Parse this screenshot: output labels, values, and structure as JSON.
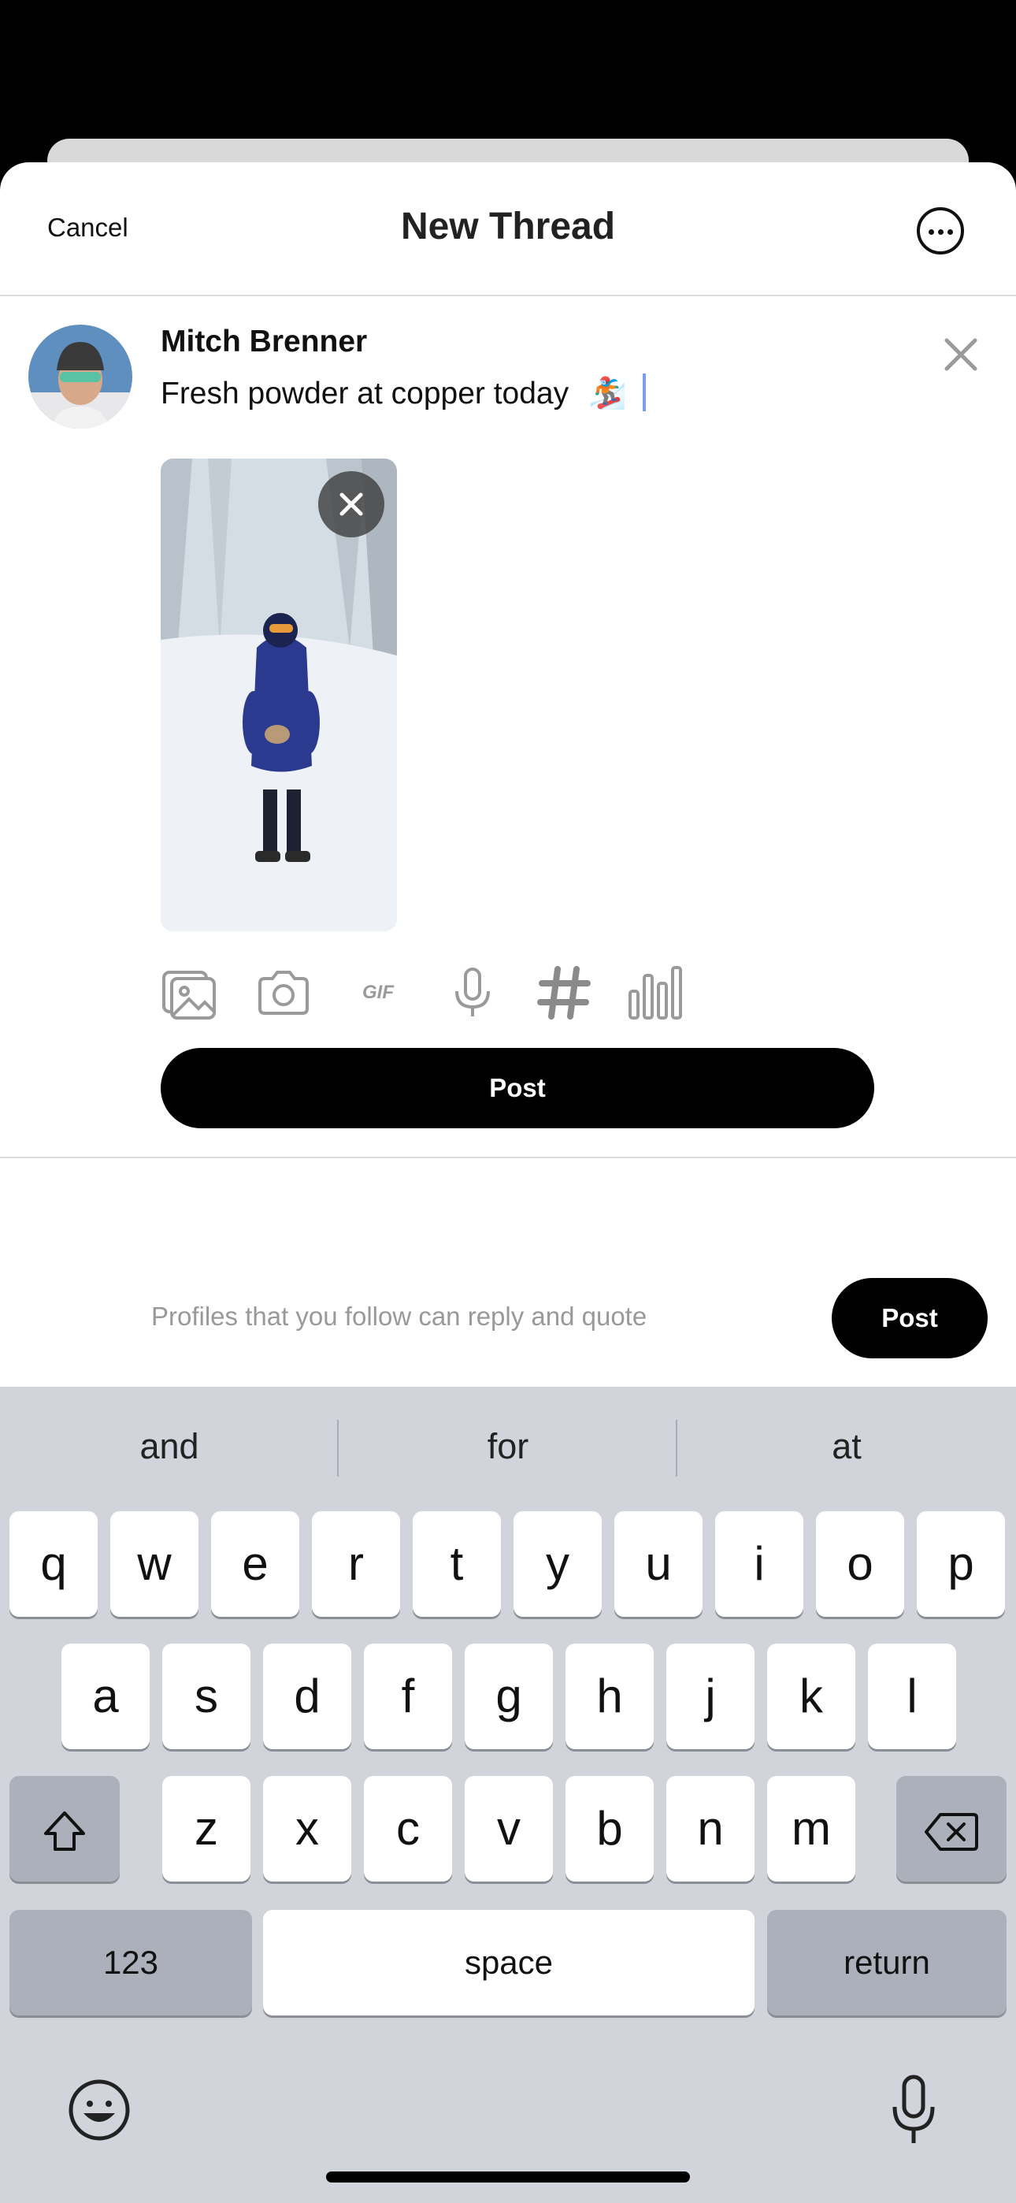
{
  "header": {
    "cancel_label": "Cancel",
    "title": "New Thread",
    "more_icon": "more-options-icon"
  },
  "compose": {
    "user_name": "Mitch Brenner",
    "text": "Fresh powder at copper today",
    "emoji": "🏂",
    "attachment": {
      "kind": "photo",
      "subject": "person in blue jacket standing in snow"
    }
  },
  "toolbar": {
    "icons": [
      "photo-library-icon",
      "camera-icon",
      "gif-icon",
      "microphone-icon",
      "hashtag-icon",
      "poll-icon"
    ],
    "gif_label": "GIF"
  },
  "post_button_label": "Post",
  "footer": {
    "reply_setting": "Profiles that you follow can reply and quote",
    "post_label": "Post"
  },
  "keyboard": {
    "suggestions": [
      "and",
      "for",
      "at"
    ],
    "row1": [
      "q",
      "w",
      "e",
      "r",
      "t",
      "y",
      "u",
      "i",
      "o",
      "p"
    ],
    "row2": [
      "a",
      "s",
      "d",
      "f",
      "g",
      "h",
      "j",
      "k",
      "l"
    ],
    "row3": [
      "z",
      "x",
      "c",
      "v",
      "b",
      "n",
      "m"
    ],
    "numbers_label": "123",
    "space_label": "space",
    "return_label": "return"
  }
}
